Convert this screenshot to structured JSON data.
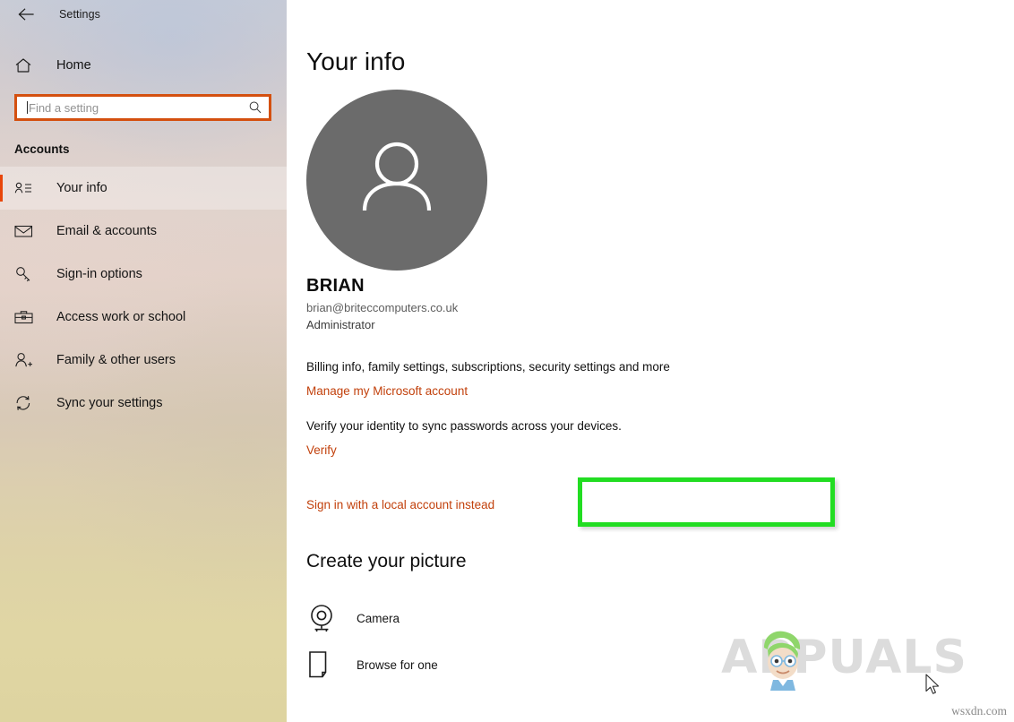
{
  "window": {
    "title": "Settings",
    "back_icon": "back-arrow-icon"
  },
  "sidebar": {
    "home": {
      "label": "Home",
      "icon": "home-icon"
    },
    "search": {
      "placeholder": "Find a setting",
      "value": "",
      "icon": "search-icon",
      "border_color": "#d4500f"
    },
    "section_label": "Accounts",
    "accent_color": "#e8460a",
    "items": [
      {
        "label": "Your info",
        "icon": "user-card-icon",
        "selected": true
      },
      {
        "label": "Email & accounts",
        "icon": "envelope-icon",
        "selected": false
      },
      {
        "label": "Sign-in options",
        "icon": "key-icon",
        "selected": false
      },
      {
        "label": "Access work or school",
        "icon": "briefcase-icon",
        "selected": false
      },
      {
        "label": "Family & other users",
        "icon": "user-add-icon",
        "selected": false
      },
      {
        "label": "Sync your settings",
        "icon": "sync-icon",
        "selected": false
      }
    ]
  },
  "main": {
    "page_title": "Your info",
    "avatar": {
      "icon": "person-avatar-icon",
      "background_color": "#6b6b6b"
    },
    "account": {
      "name": "BRIAN",
      "email": "brian@briteccomputers.co.uk",
      "role": "Administrator"
    },
    "billing_text": "Billing info, family settings, subscriptions, security settings and more",
    "manage_link": "Manage my Microsoft account",
    "verify_text": "Verify your identity to sync passwords across your devices.",
    "verify_link": "Verify",
    "local_account_link": "Sign in with a local account instead",
    "link_color": "#c2410c",
    "highlight_color": "#22dd22",
    "create_picture": {
      "heading": "Create your picture",
      "options": [
        {
          "label": "Camera",
          "icon": "webcam-icon"
        },
        {
          "label": "Browse for one",
          "icon": "document-icon"
        }
      ]
    }
  },
  "watermark": {
    "brand": "APPUALS",
    "site": "wsxdn.com",
    "mascot_icon": "appuals-mascot-icon"
  },
  "cursor": {
    "icon": "mouse-pointer-icon"
  }
}
